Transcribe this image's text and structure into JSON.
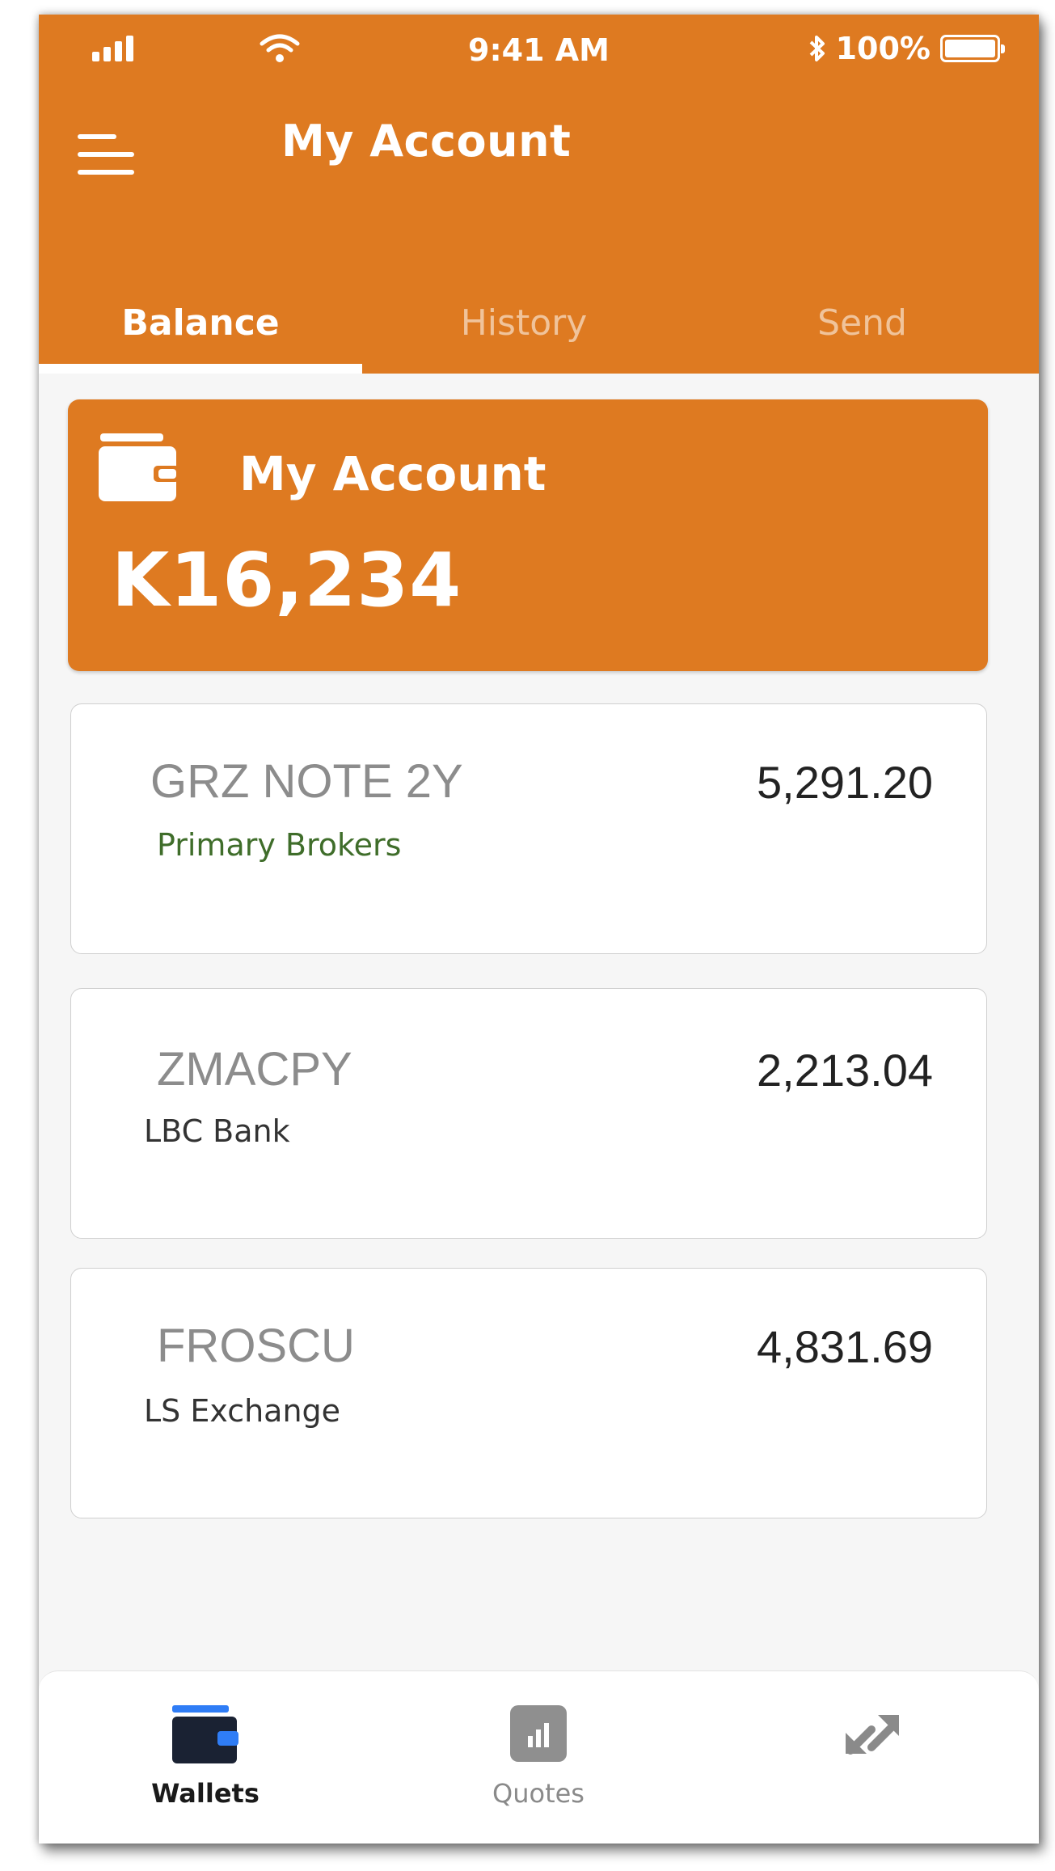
{
  "status_bar": {
    "time": "9:41 AM",
    "battery": "100%"
  },
  "header": {
    "title": "My Account",
    "menu_icon": "hamburger-menu-icon"
  },
  "tabs": [
    {
      "label": "Balance",
      "active": true
    },
    {
      "label": "History",
      "active": false
    },
    {
      "label": "Send",
      "active": false
    }
  ],
  "account": {
    "name": "My Account",
    "balance": "K16,234",
    "icon": "wallet-icon"
  },
  "holdings": [
    {
      "code": "GRZ NOTE 2Y",
      "issuer": "Primary Brokers",
      "value": "5,291.20"
    },
    {
      "code": "ZMACPY",
      "issuer": "LBC Bank",
      "value": "2,213.04"
    },
    {
      "code": "FROSCU",
      "issuer": "LS Exchange",
      "value": "4,831.69"
    }
  ],
  "bottom_nav": [
    {
      "label": "Wallets",
      "icon": "wallet-icon",
      "active": true
    },
    {
      "label": "Quotes",
      "icon": "bar-chart-icon",
      "active": false
    },
    {
      "label": "",
      "icon": "exchange-arrows-icon",
      "active": false
    }
  ],
  "colors": {
    "accent": "#de7a21",
    "active_nav": "#1a2233",
    "nav_highlight": "#2f7df6",
    "issuer_green": "#3f6d2a"
  }
}
